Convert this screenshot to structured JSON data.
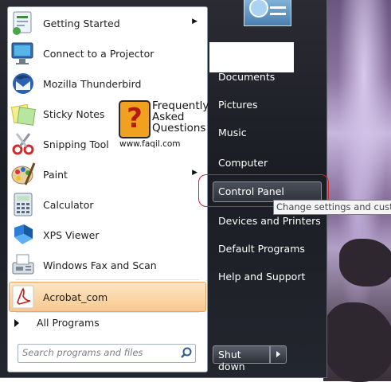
{
  "programs": [
    {
      "label": "Getting Started",
      "icon": "getting-started-icon",
      "submenu": true
    },
    {
      "label": "Connect to a Projector",
      "icon": "projector-icon",
      "submenu": false
    },
    {
      "label": "Mozilla Thunderbird",
      "icon": "thunderbird-icon",
      "submenu": false
    },
    {
      "label": "Sticky Notes",
      "icon": "sticky-notes-icon",
      "submenu": false
    },
    {
      "label": "Snipping Tool",
      "icon": "scissors-icon",
      "submenu": false
    },
    {
      "label": "Paint",
      "icon": "paint-palette-icon",
      "submenu": true
    },
    {
      "label": "Calculator",
      "icon": "calculator-icon",
      "submenu": false
    },
    {
      "label": "XPS Viewer",
      "icon": "xps-viewer-icon",
      "submenu": false
    },
    {
      "label": "Windows Fax and Scan",
      "icon": "fax-icon",
      "submenu": false
    },
    {
      "label": "Acrobat_com",
      "icon": "acrobat-icon",
      "submenu": false
    }
  ],
  "all_programs": "All Programs",
  "search": {
    "placeholder": "Search programs and files"
  },
  "faq": {
    "line1": "Frequently",
    "line2": "Asked",
    "line3": "Questions",
    "url": "www.faqil.com",
    "badge": "?"
  },
  "right_items": {
    "documents": "Documents",
    "pictures": "Pictures",
    "music": "Music",
    "computer": "Computer",
    "control_panel": "Control Panel",
    "devices": "Devices and Printers",
    "default_programs": "Default Programs",
    "help": "Help and Support"
  },
  "tooltip": "Change settings and customize the functionality of this computer.",
  "shutdown": "Shut down",
  "colors": {
    "highlight": "#f8c890",
    "annotation_ring": "#d9232b",
    "menu_bg": "#1b1d24"
  }
}
